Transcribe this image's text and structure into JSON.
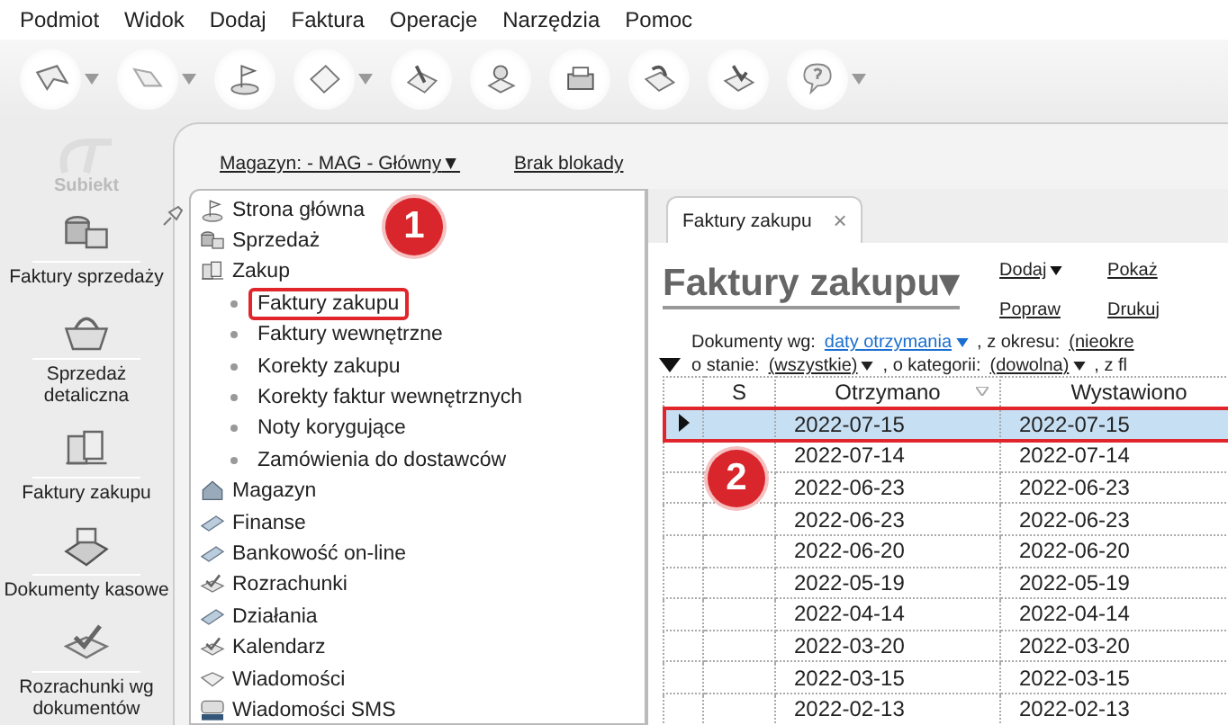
{
  "menu": [
    "Podmiot",
    "Widok",
    "Dodaj",
    "Faktura",
    "Operacje",
    "Narzędzia",
    "Pomoc"
  ],
  "toolbar": [
    {
      "dropdown": true
    },
    {
      "dropdown": true
    },
    {
      "dropdown": false
    },
    {
      "dropdown": true
    },
    {
      "dropdown": false
    },
    {
      "dropdown": false
    },
    {
      "dropdown": false
    },
    {
      "dropdown": false
    },
    {
      "dropdown": false
    },
    {
      "dropdown": true
    }
  ],
  "logo": {
    "text": "Subiekt"
  },
  "sidebar": {
    "items": [
      {
        "label": "Faktury sprzedaży"
      },
      {
        "label": "Sprzedaż detaliczna"
      },
      {
        "label": "Faktury zakupu"
      },
      {
        "label": "Dokumenty kasowe"
      },
      {
        "label": "Rozrachunki wg dokumentów"
      }
    ]
  },
  "location_bar": {
    "warehouse": "Magazyn: - MAG - Główny",
    "warehouse_dropdown": "▼",
    "lock": "Brak blokady"
  },
  "tree": {
    "items": [
      {
        "label": "Strona główna"
      },
      {
        "label": "Sprzedaż"
      },
      {
        "label": "Zakup",
        "children": [
          {
            "label": "Faktury zakupu",
            "selected": true
          },
          {
            "label": "Faktury wewnętrzne",
            "selected": false
          },
          {
            "label": "Korekty zakupu",
            "selected": false
          },
          {
            "label": "Korekty faktur wewnętrznych",
            "selected": false
          },
          {
            "label": "Noty korygujące",
            "selected": false
          },
          {
            "label": "Zamówienia do dostawców",
            "selected": false
          }
        ]
      },
      {
        "label": "Magazyn"
      },
      {
        "label": "Finanse"
      },
      {
        "label": "Bankowość on-line"
      },
      {
        "label": "Rozrachunki"
      },
      {
        "label": "Działania"
      },
      {
        "label": "Kalendarz"
      },
      {
        "label": "Wiadomości"
      },
      {
        "label": "Wiadomości SMS"
      }
    ]
  },
  "tab": {
    "label": "Faktury zakupu",
    "close": "×"
  },
  "view": {
    "title": "Faktury zakupu",
    "title_caret": "▾",
    "actions": [
      {
        "label": "Dodaj",
        "dropdown": true
      },
      {
        "label": "Pokaż",
        "dropdown": false
      },
      {
        "label": "Popraw",
        "dropdown": false
      },
      {
        "label": "Drukuj",
        "dropdown": false
      }
    ]
  },
  "filters": [
    [
      {
        "kind": "label",
        "text": "Dokumenty wg:"
      },
      {
        "kind": "link",
        "text": "daty otrzymania",
        "dropdown": true,
        "color": "#1a6fd0"
      },
      {
        "kind": "label",
        "text": ", z okresu:"
      },
      {
        "kind": "link",
        "text": "(nieokre",
        "dropdown": false,
        "color": "#222222"
      }
    ],
    [
      {
        "kind": "label",
        "text": "o stanie:"
      },
      {
        "kind": "link",
        "text": "(wszystkie)",
        "dropdown": true,
        "color": "#222222"
      },
      {
        "kind": "label",
        "text": ", o kategorii:"
      },
      {
        "kind": "link",
        "text": "(dowolna)",
        "dropdown": true,
        "color": "#222222"
      },
      {
        "kind": "label",
        "text": ", z fl"
      }
    ]
  ],
  "table": {
    "columns": [
      "S",
      "Otrzymano",
      "Wystawiono"
    ],
    "rows": [
      {
        "selected": true,
        "cells": [
          "",
          "2022-07-15",
          "2022-07-15"
        ]
      },
      {
        "selected": false,
        "cells": [
          "",
          "2022-07-14",
          "2022-07-14"
        ]
      },
      {
        "selected": false,
        "cells": [
          "",
          "2022-06-23",
          "2022-06-23"
        ]
      },
      {
        "selected": false,
        "cells": [
          "",
          "2022-06-23",
          "2022-06-23"
        ]
      },
      {
        "selected": false,
        "cells": [
          "",
          "2022-06-20",
          "2022-06-20"
        ]
      },
      {
        "selected": false,
        "cells": [
          "",
          "2022-05-19",
          "2022-05-19"
        ]
      },
      {
        "selected": false,
        "cells": [
          "",
          "2022-04-14",
          "2022-04-14"
        ]
      },
      {
        "selected": false,
        "cells": [
          "",
          "2022-03-20",
          "2022-03-20"
        ]
      },
      {
        "selected": false,
        "cells": [
          "",
          "2022-03-15",
          "2022-03-15"
        ]
      },
      {
        "selected": false,
        "cells": [
          "",
          "2022-02-13",
          "2022-02-13"
        ]
      }
    ]
  },
  "annotations": [
    {
      "label": "1"
    },
    {
      "label": "2"
    }
  ]
}
